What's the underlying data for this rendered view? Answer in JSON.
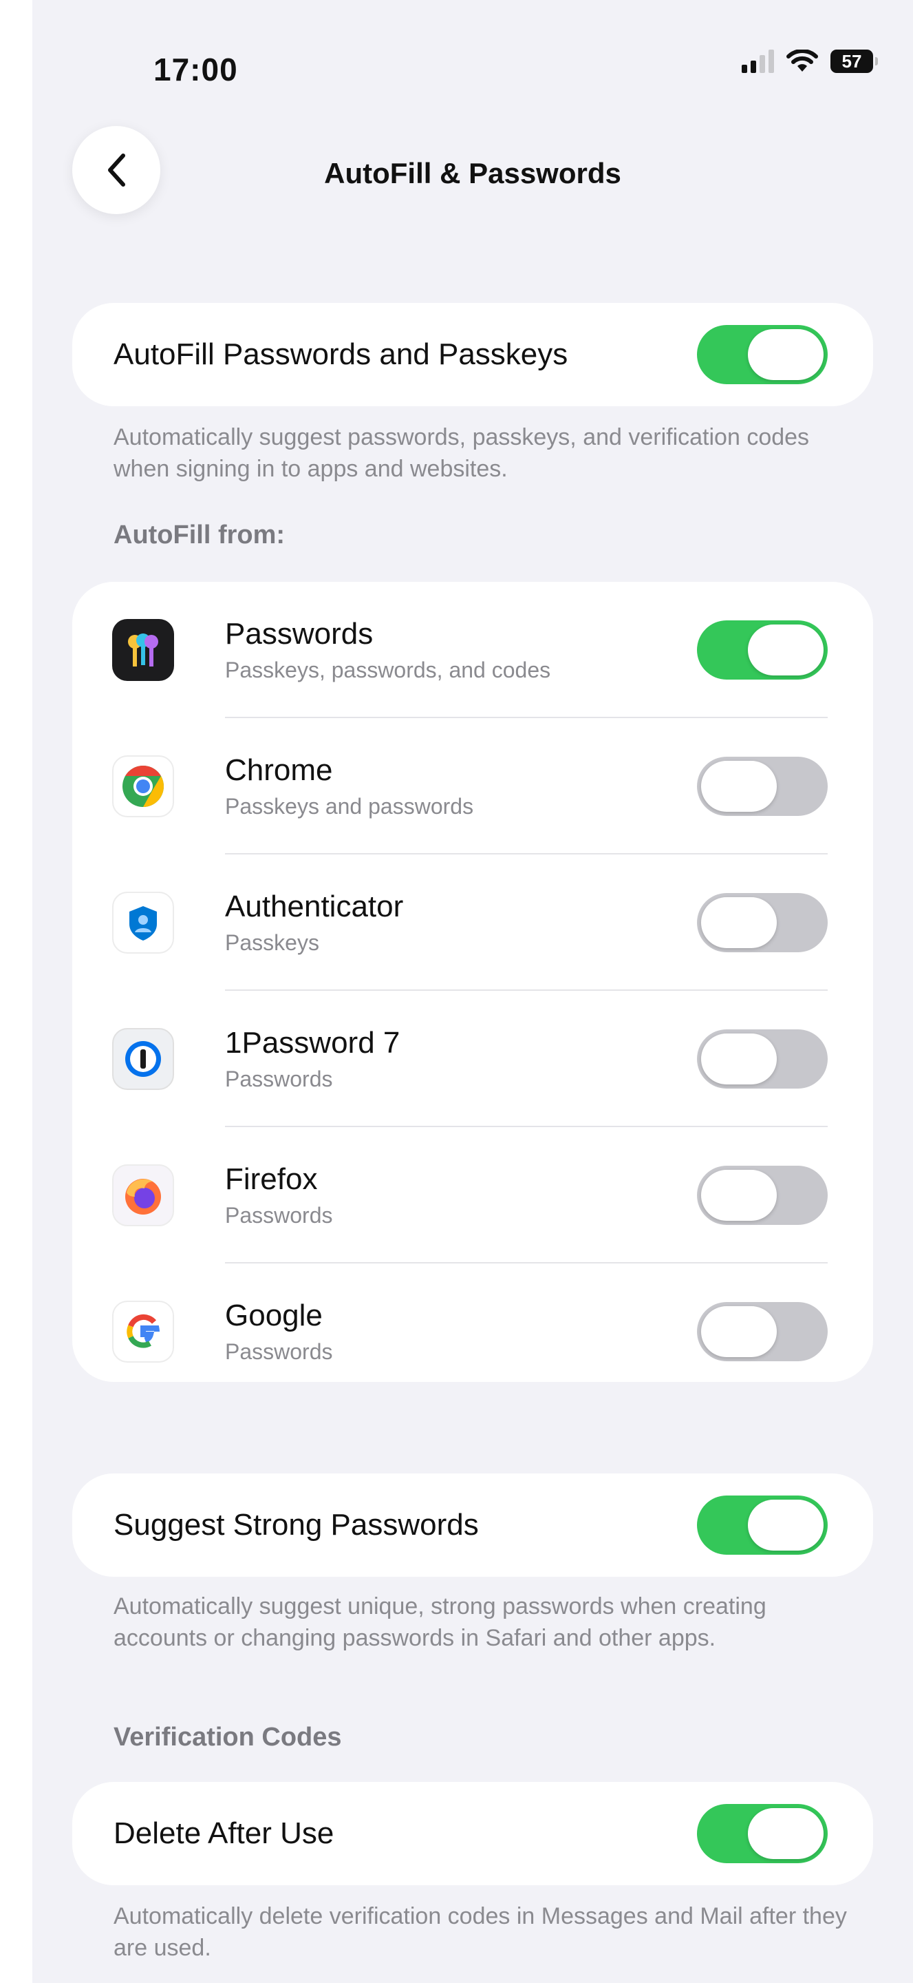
{
  "status_bar": {
    "time": "17:00",
    "battery": "57"
  },
  "nav": {
    "title": "AutoFill & Passwords"
  },
  "autofill": {
    "label": "AutoFill Passwords and Passkeys",
    "enabled": true,
    "footnote": "Automatically suggest passwords, passkeys, and verification codes when signing in to apps and websites."
  },
  "autofill_from": {
    "header": "AutoFill from:",
    "apps": [
      {
        "name": "Passwords",
        "detail": "Passkeys, passwords, and codes",
        "enabled": true,
        "icon": "passwords-app-icon"
      },
      {
        "name": "Chrome",
        "detail": "Passkeys and passwords",
        "enabled": false,
        "icon": "chrome-icon"
      },
      {
        "name": "Authenticator",
        "detail": "Passkeys",
        "enabled": false,
        "icon": "authenticator-icon"
      },
      {
        "name": "1Password 7",
        "detail": "Passwords",
        "enabled": false,
        "icon": "1password-icon"
      },
      {
        "name": "Firefox",
        "detail": "Passwords",
        "enabled": false,
        "icon": "firefox-icon"
      },
      {
        "name": "Google",
        "detail": "Passwords",
        "enabled": false,
        "icon": "google-icon"
      }
    ]
  },
  "strong_passwords": {
    "label": "Suggest Strong Passwords",
    "enabled": true,
    "footnote": "Automatically suggest unique, strong passwords when creating accounts or changing passwords in Safari and other apps."
  },
  "verification_codes": {
    "header": "Verification Codes",
    "label": "Delete After Use",
    "enabled": true,
    "footnote": "Automatically delete verification codes in Messages and Mail after they are used."
  },
  "colors": {
    "toggle_on": "#34c759",
    "toggle_off": "#c7c7cc",
    "background": "#f2f2f7"
  }
}
